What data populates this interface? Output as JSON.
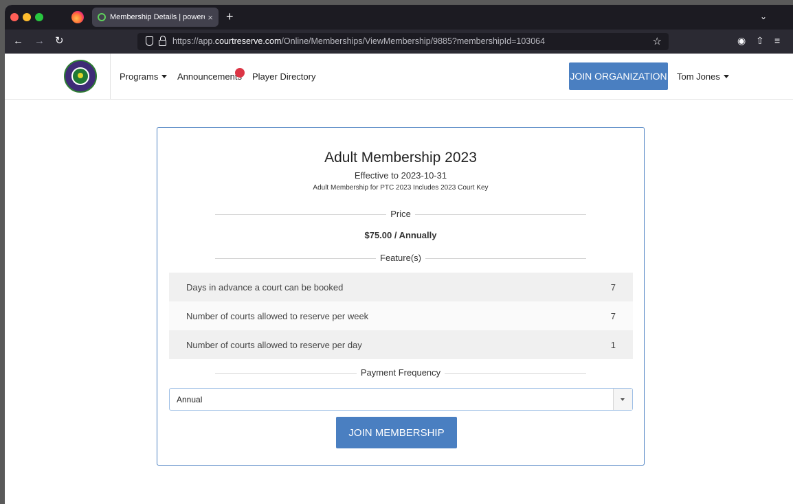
{
  "browser": {
    "tab_title": "Membership Details | powered b",
    "new_tab": "+",
    "tab_close": "×",
    "url_prefix": "https://app.",
    "url_host": "courtreserve.com",
    "url_path": "/Online/Memberships/ViewMembership/9885?membershipId=103064"
  },
  "site": {
    "nav": {
      "programs": "Programs",
      "announcements": "Announcements",
      "player_directory": "Player Directory"
    },
    "join_org_label": "JOIN ORGANIZATION",
    "user_name": "Tom Jones"
  },
  "membership": {
    "title": "Adult Membership 2023",
    "effective": "Effective to 2023-10-31",
    "description": "Adult Membership for PTC 2023 Includes 2023 Court Key",
    "price_heading": "Price",
    "price": "$75.00 / Annually",
    "features_heading": "Feature(s)",
    "features": [
      {
        "label": "Days in advance a court can be booked",
        "value": "7"
      },
      {
        "label": "Number of courts allowed to reserve per week",
        "value": "7"
      },
      {
        "label": "Number of courts allowed to reserve per day",
        "value": "1"
      }
    ],
    "payment_heading": "Payment Frequency",
    "payment_selected": "Annual",
    "join_label": "JOIN MEMBERSHIP"
  },
  "colors": {
    "primary": "#4a7fc1",
    "notification": "#dc3545",
    "browser_chrome": "#1c1b22"
  }
}
